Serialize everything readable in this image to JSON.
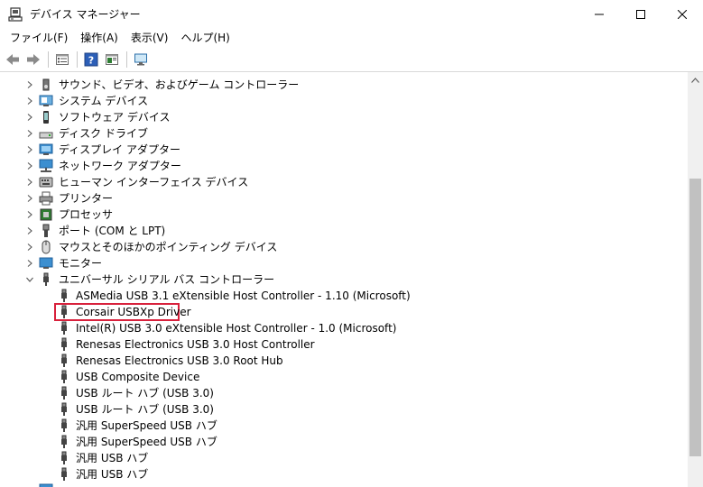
{
  "window": {
    "title": "デバイス マネージャー",
    "controls": {
      "minimize": "minimize",
      "maximize": "maximize",
      "close": "close"
    }
  },
  "menu": [
    {
      "label": "ファイル(F)"
    },
    {
      "label": "操作(A)"
    },
    {
      "label": "表示(V)"
    },
    {
      "label": "ヘルプ(H)"
    }
  ],
  "toolbar": [
    {
      "name": "back-button",
      "icon": "back-arrow-icon"
    },
    {
      "name": "forward-button",
      "icon": "forward-arrow-icon"
    },
    {
      "name": "properties-button",
      "icon": "properties-icon"
    },
    {
      "name": "help-button",
      "icon": "help-icon"
    },
    {
      "name": "view-button",
      "icon": "view-icon"
    },
    {
      "name": "scan-hardware-button",
      "icon": "monitor-icon"
    }
  ],
  "tree": {
    "categories": [
      {
        "label": "サウンド、ビデオ、およびゲーム コントローラー",
        "icon": "speaker-icon",
        "expanded": false
      },
      {
        "label": "システム デバイス",
        "icon": "system-device-icon",
        "expanded": false
      },
      {
        "label": "ソフトウェア デバイス",
        "icon": "software-device-icon",
        "expanded": false
      },
      {
        "label": "ディスク ドライブ",
        "icon": "disk-drive-icon",
        "expanded": false
      },
      {
        "label": "ディスプレイ アダプター",
        "icon": "display-adapter-icon",
        "expanded": false
      },
      {
        "label": "ネットワーク アダプター",
        "icon": "network-adapter-icon",
        "expanded": false
      },
      {
        "label": "ヒューマン インターフェイス デバイス",
        "icon": "hid-icon",
        "expanded": false
      },
      {
        "label": "プリンター",
        "icon": "printer-icon",
        "expanded": false
      },
      {
        "label": "プロセッサ",
        "icon": "processor-icon",
        "expanded": false
      },
      {
        "label": "ポート (COM と LPT)",
        "icon": "port-icon",
        "expanded": false
      },
      {
        "label": "マウスとそのほかのポインティング デバイス",
        "icon": "mouse-icon",
        "expanded": false
      },
      {
        "label": "モニター",
        "icon": "monitor-icon",
        "expanded": false
      },
      {
        "label": "ユニバーサル シリアル バス コントローラー",
        "icon": "usb-icon",
        "expanded": true
      }
    ],
    "usb_children": [
      {
        "label": "ASMedia USB 3.1 eXtensible Host Controller - 1.10 (Microsoft)"
      },
      {
        "label": "Corsair USBXp Driver",
        "highlighted": true
      },
      {
        "label": "Intel(R) USB 3.0 eXtensible Host Controller - 1.0 (Microsoft)"
      },
      {
        "label": "Renesas Electronics USB 3.0 Host Controller"
      },
      {
        "label": "Renesas Electronics USB 3.0 Root Hub"
      },
      {
        "label": "USB Composite Device"
      },
      {
        "label": "USB ルート ハブ (USB 3.0)"
      },
      {
        "label": "USB ルート ハブ (USB 3.0)"
      },
      {
        "label": "汎用 SuperSpeed USB ハブ"
      },
      {
        "label": "汎用 SuperSpeed USB ハブ"
      },
      {
        "label": "汎用 USB ハブ"
      },
      {
        "label": "汎用 USB ハブ"
      }
    ]
  },
  "colors": {
    "highlight_border": "#d8213c",
    "scrollbar_track": "#f0f0f0",
    "scrollbar_thumb": "#c1c1c1"
  }
}
